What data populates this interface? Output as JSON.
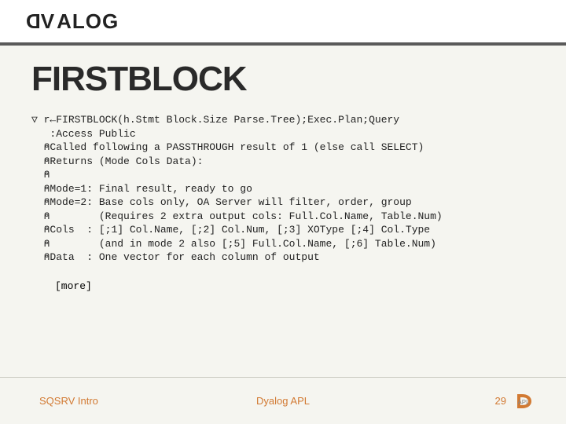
{
  "header": {
    "brand": "DYALOG"
  },
  "title": "FIRSTBLOCK",
  "code": {
    "nabla": "▽",
    "l0": " r←FIRSTBLOCK(h.Stmt Block.Size Parse.Tree);Exec.Plan;Query",
    "l1": "   :Access Public",
    "l2": "  ⍝Called following a PASSTHROUGH result of 1 (else call SELECT)",
    "l3": "  ⍝Returns (Mode Cols Data):",
    "l4": "  ⍝",
    "l5": "  ⍝Mode=1: Final result, ready to go",
    "l6": "  ⍝Mode=2: Base cols only, OA Server will filter, order, group",
    "l7": "  ⍝        (Requires 2 extra output cols: Full.Col.Name, Table.Num)",
    "l8": "  ⍝Cols  : [;1] Col.Name, [;2] Col.Num, [;3] XOType [;4] Col.Type",
    "l9": "  ⍝        (and in mode 2 also [;5] Full.Col.Name, [;6] Table.Num)",
    "l10": "  ⍝Data  : One vector for each column of output"
  },
  "more": "[more]",
  "footer": {
    "left": "SQSRV Intro",
    "center": "Dyalog APL",
    "page": "29"
  }
}
